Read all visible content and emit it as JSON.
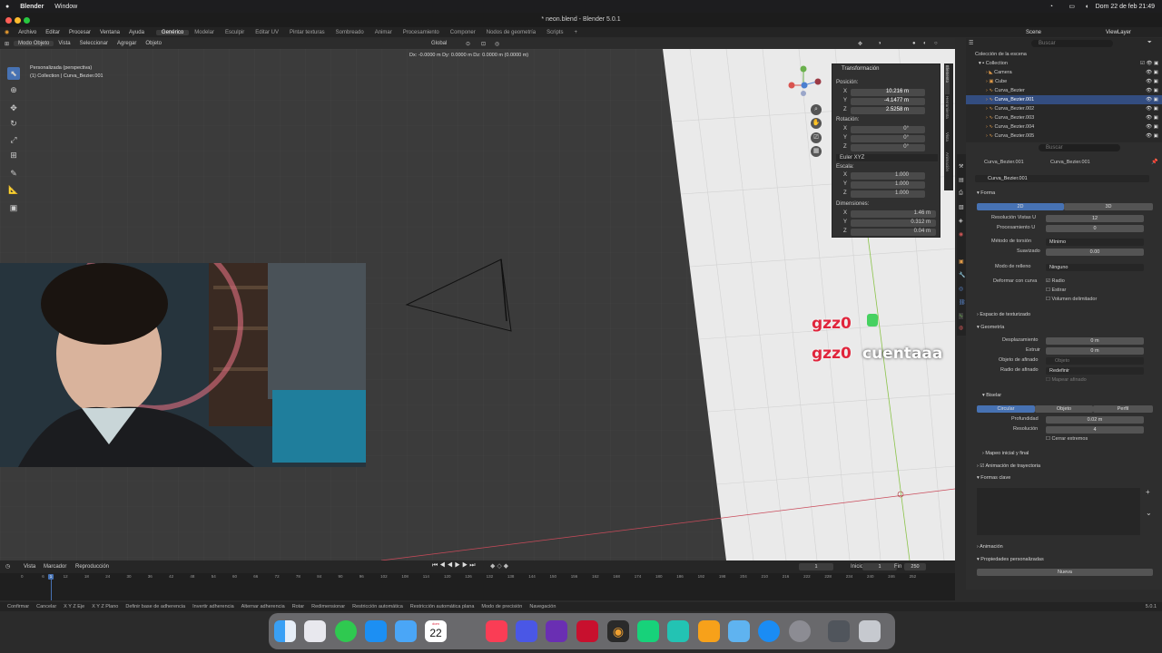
{
  "macbar": {
    "app": "Blender",
    "window": "Window",
    "datetime": "Dom 22 de feb  21:49"
  },
  "title": "* neon.blend - Blender 5.0.1",
  "menu": [
    "Archivo",
    "Editar",
    "Procesar",
    "Ventana",
    "Ayuda"
  ],
  "workspaces": [
    "Genérico",
    "Modelar",
    "Esculpir",
    "Editar UV",
    "Pintar texturas",
    "Sombreado",
    "Animar",
    "Procesamiento",
    "Componer",
    "Nodos de geometría",
    "Scripts"
  ],
  "scene": "Scene",
  "viewlayer": "ViewLayer",
  "viewport_header": {
    "mode": "Modo Objeto",
    "menus": [
      "Vista",
      "Seleccionar",
      "Agregar",
      "Objeto"
    ],
    "orientation": "Global"
  },
  "viewport": {
    "info_line1": "Personalizada (perspectiva)",
    "info_line2": "(1) Collection | Curva_Bezier.001",
    "delta": "Dx: -0.0000 m  Dy: 0.0000 m  Dz: 0.0000 m (0.0000 m)",
    "chat1": "gzz0",
    "chat2": "gzz0",
    "chat2_msg": "cuentaaa"
  },
  "npanel": {
    "title": "Transformación",
    "position_label": "Posición:",
    "pos": [
      {
        "axis": "X",
        "val": "10.216 m"
      },
      {
        "axis": "Y",
        "val": "-4.1477 m"
      },
      {
        "axis": "Z",
        "val": "2.5258 m"
      }
    ],
    "rotation_label": "Rotación:",
    "rot": [
      {
        "axis": "X",
        "val": "0°"
      },
      {
        "axis": "Y",
        "val": "0°"
      },
      {
        "axis": "Z",
        "val": "0°"
      }
    ],
    "euler": "Euler XYZ",
    "scale_label": "Escala:",
    "scale": [
      {
        "axis": "X",
        "val": "1.000"
      },
      {
        "axis": "Y",
        "val": "1.000"
      },
      {
        "axis": "Z",
        "val": "1.000"
      }
    ],
    "dim_label": "Dimensiones:",
    "dim": [
      {
        "axis": "X",
        "val": "1.46 m"
      },
      {
        "axis": "Y",
        "val": "0.312 m"
      },
      {
        "axis": "Z",
        "val": "0.04 m"
      }
    ],
    "tabs": [
      "Elemento",
      "Herramienta",
      "Vista",
      "Animación"
    ]
  },
  "outliner": {
    "search": "Buscar",
    "root": "Colección de la escena",
    "items": [
      "Collection",
      "Camera",
      "Cube",
      "Curva_Bezier",
      "Curva_Bezier.001",
      "Curva_Bezier.002",
      "Curva_Bezier.003",
      "Curva_Bezier.004",
      "Curva_Bezier.005"
    ]
  },
  "props": {
    "search": "Buscar",
    "breadcrumb1": "Curva_Bezier.001",
    "breadcrumb2": "Curva_Bezier.001",
    "datablock": "Curva_Bezier.001",
    "forma": "Forma",
    "d2": "2D",
    "d3": "3D",
    "res_label": "Resolución  Vistas U",
    "res_val": "12",
    "proc_label": "Procesamiento U",
    "proc_val": "0",
    "torsion_label": "Método de torsión",
    "torsion_val": "Mínimo",
    "suav_label": "Suavizado",
    "suav_val": "0.00",
    "relleno_label": "Modo de relleno",
    "relleno_val": "Ninguno",
    "deform_label": "Deformar con curva",
    "radio": "Radio",
    "estirar": "Estirar",
    "volumen": "Volumen delimitador",
    "texturizado": "Espacio de texturizado",
    "geometria": "Geometría",
    "despl_label": "Desplazamiento",
    "despl_val": "0 m",
    "extruir_label": "Extruir",
    "extruir_val": "0 m",
    "obj_afin_label": "Objeto de afinado",
    "obj_afin_val": "Objeto",
    "radio_afin_label": "Radio de afinado",
    "radio_afin_val": "Redefinir",
    "mapear_afinado": "Mapear afinado",
    "biselar": "Biselar",
    "bis_circular": "Circular",
    "bis_objeto": "Objeto",
    "bis_perfil": "Perfil",
    "prof_label": "Profundidad",
    "prof_val": "0.02 m",
    "resol_label": "Resolución",
    "resol_val": "4",
    "cerrar": "Cerrar extremos",
    "mapeo": "Mapeo inicial y final",
    "anim_tray": "Animación de trayectoria",
    "formas_clave": "Formas clave",
    "animacion": "Animación",
    "prop_pers": "Propiedades personalizadas",
    "nueva": "Nueva"
  },
  "timeline": {
    "menus": [
      "Vista",
      "Marcador",
      "Reproducción"
    ],
    "frame": "1",
    "inicio_label": "Inicio",
    "inicio": "1",
    "fin_label": "Fin",
    "fin": "250",
    "ticks": [
      "0",
      "6",
      "12",
      "18",
      "24",
      "30",
      "36",
      "42",
      "48",
      "54",
      "60",
      "66",
      "72",
      "78",
      "84",
      "90",
      "96",
      "102",
      "108",
      "114",
      "120",
      "126",
      "132",
      "138",
      "144",
      "150",
      "156",
      "162",
      "168",
      "174",
      "180",
      "186",
      "192",
      "198",
      "204",
      "210",
      "216",
      "222",
      "228",
      "234",
      "240",
      "246",
      "252"
    ]
  },
  "status": [
    "Confirmar",
    "Cancelar",
    "X Y Z Eje",
    "X Y Z Plano",
    "Definir base de adherencia",
    "Invertir adherencia",
    "Alternar adherencia",
    "Rotar",
    "Redimensionar",
    "Restricción automática",
    "Restricción automática plana",
    "Modo de precisión",
    "Navegación"
  ],
  "version": "5.0.1",
  "dock_date": "22",
  "dock_month": "dom",
  "colors": {
    "accent": "#4772b3",
    "chat_red": "#e0253c",
    "bg": "#3b3b3b"
  }
}
